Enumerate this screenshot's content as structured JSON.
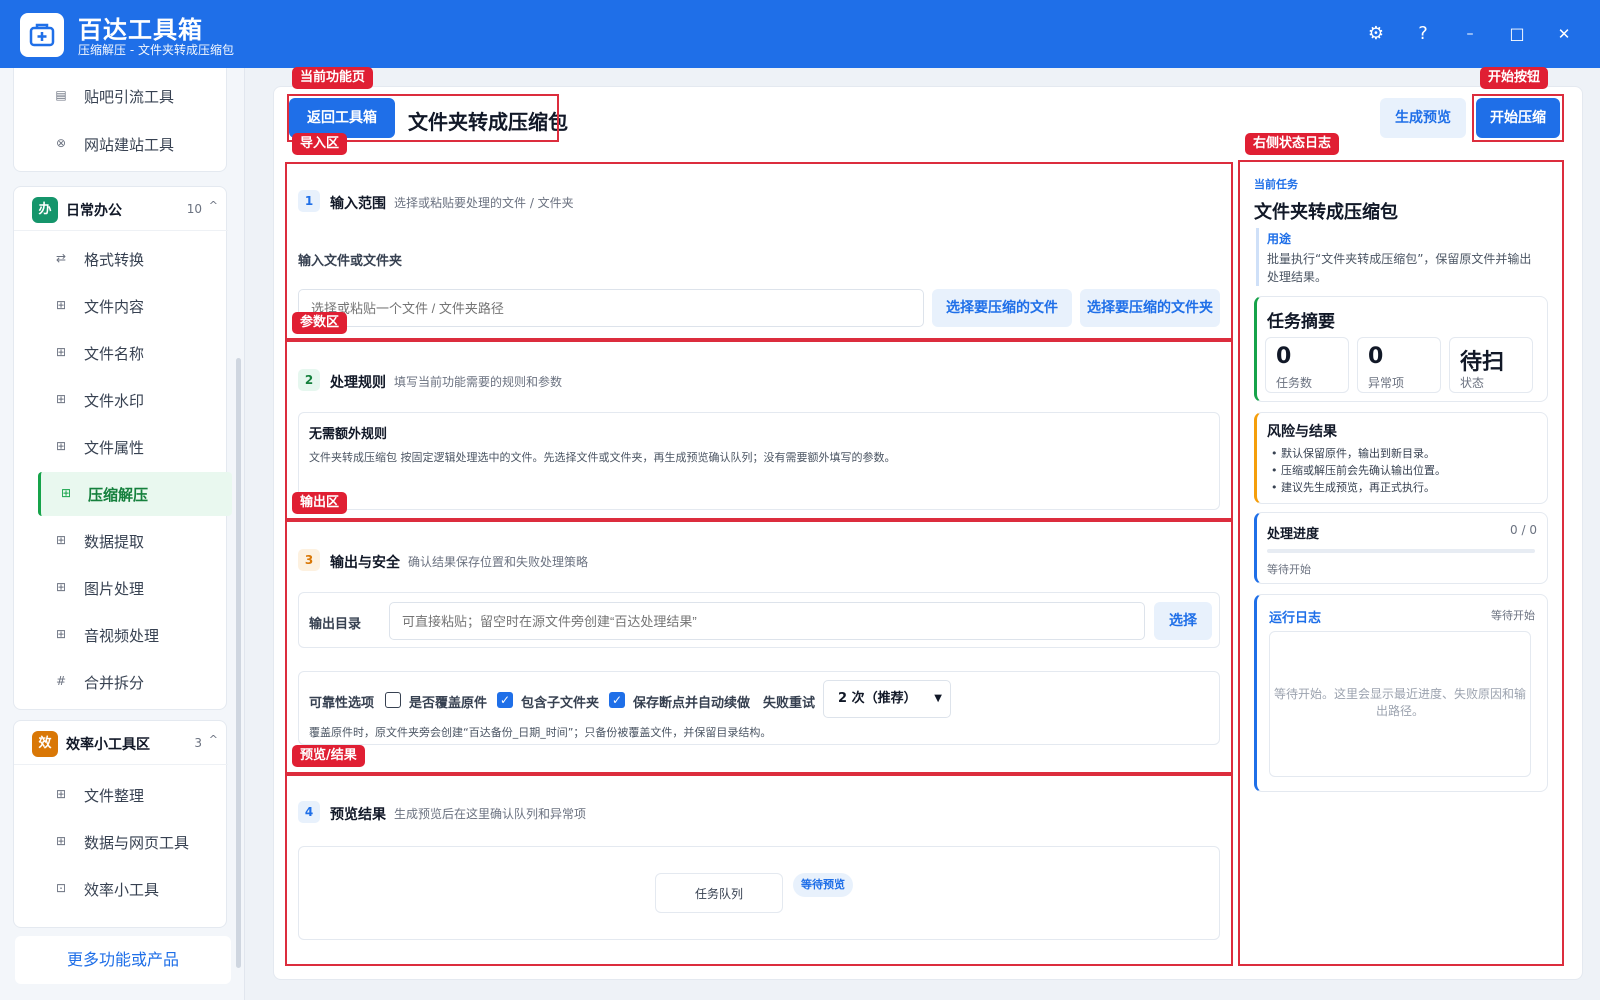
{
  "app": {
    "title": "百达工具箱",
    "subtitle": "压缩解压 - 文件夹转成压缩包"
  },
  "window_controls": {
    "settings": "⚙",
    "help": "?",
    "minimize": "–",
    "maximize": "□",
    "close": "✕"
  },
  "sidebar": {
    "top_items": [
      {
        "label": "贴吧引流工具",
        "icon": "post-icon"
      },
      {
        "label": "网站建站工具",
        "icon": "globe-icon"
      }
    ],
    "group_office": {
      "badge": "办",
      "title": "日常办公",
      "count": "10",
      "caret": "^",
      "badge_color": "#15956b",
      "items": [
        {
          "label": "格式转换",
          "icon": "swap-icon"
        },
        {
          "label": "文件内容",
          "icon": "grid-icon"
        },
        {
          "label": "文件名称",
          "icon": "grid-icon"
        },
        {
          "label": "文件水印",
          "icon": "grid-icon"
        },
        {
          "label": "文件属性",
          "icon": "grid-icon"
        },
        {
          "label": "压缩解压",
          "icon": "grid-icon",
          "active": true
        },
        {
          "label": "数据提取",
          "icon": "grid-icon"
        },
        {
          "label": "图片处理",
          "icon": "grid-icon"
        },
        {
          "label": "音视频处理",
          "icon": "grid-icon"
        },
        {
          "label": "合并拆分",
          "icon": "hash-icon"
        }
      ]
    },
    "group_tools": {
      "badge": "效",
      "title": "效率小工具区",
      "count": "3",
      "caret": "^",
      "badge_color": "#d97706",
      "items": [
        {
          "label": "文件整理",
          "icon": "grid-icon"
        },
        {
          "label": "数据与网页工具",
          "icon": "grid-icon"
        },
        {
          "label": "效率小工具",
          "icon": "toolbox-icon"
        }
      ]
    },
    "more": "更多功能或产品"
  },
  "header": {
    "back": "返回工具箱",
    "title": "文件夹转成压缩包",
    "preview": "生成预览",
    "start": "开始压缩"
  },
  "annotations": {
    "current_page": "当前功能页",
    "start_button": "开始按钮",
    "import_area": "导入区",
    "log_area": "右侧状态日志",
    "param_area": "参数区",
    "output_area": "输出区",
    "preview_area": "预览/结果"
  },
  "section1": {
    "step": "1",
    "title": "输入范围",
    "hint": "选择或粘贴要处理的文件 / 文件夹",
    "field_label": "输入文件或文件夹",
    "placeholder": "选择或粘贴一个文件 / 文件夹路径",
    "btn_file": "选择要压缩的文件",
    "btn_folder": "选择要压缩的文件夹"
  },
  "section2": {
    "step": "2",
    "title": "处理规则",
    "hint": "填写当前功能需要的规则和参数",
    "box_title": "无需额外规则",
    "box_desc": "文件夹转成压缩包 按固定逻辑处理选中的文件。先选择文件或文件夹，再生成预览确认队列；没有需要额外填写的参数。"
  },
  "section3": {
    "step": "3",
    "title": "输出与安全",
    "hint": "确认结果保存位置和失败处理策略",
    "out_label": "输出目录",
    "out_placeholder": "可直接粘贴；留空时在源文件旁创建“百达处理结果”",
    "out_btn": "选择",
    "rel_label": "可靠性选项",
    "opt_overwrite": "是否覆盖原件",
    "opt_sub": "包含子文件夹",
    "opt_resume": "保存断点并自动续做",
    "retry_label": "失败重试",
    "retry_value": "2 次（推荐）",
    "note": "覆盖原件时，原文件夹旁会创建“百达备份_日期_时间”；只备份被覆盖文件，并保留目录结构。"
  },
  "section4": {
    "step": "4",
    "title": "预览结果",
    "hint": "生成预览后在这里确认队列和异常项",
    "queue": "任务队列",
    "status": "等待预览"
  },
  "right": {
    "task_label": "当前任务",
    "task_title": "文件夹转成压缩包",
    "usage_label": "用途",
    "usage_desc": "批量执行“文件夹转成压缩包”，保留原文件并输出处理结果。",
    "summary_title": "任务摘要",
    "stats": [
      {
        "value": "0",
        "label": "任务数"
      },
      {
        "value": "0",
        "label": "异常项"
      },
      {
        "value": "待扫",
        "label": "状态"
      }
    ],
    "risk_title": "风险与结果",
    "risk_items": [
      "默认保留原件，输出到新目录。",
      "压缩或解压前会先确认输出位置。",
      "建议先生成预览，再正式执行。"
    ],
    "progress_title": "处理进度",
    "progress_count": "0 / 0",
    "progress_fraction": 0,
    "progress_status": "等待开始",
    "log_title": "运行日志",
    "log_status": "等待开始",
    "log_placeholder": "等待开始。这里会显示最近进度、失败原因和输出路径。"
  },
  "colors": {
    "primary": "#1f6fe8",
    "annotation": "#dc2d3d",
    "active_green": "#16a34a"
  }
}
